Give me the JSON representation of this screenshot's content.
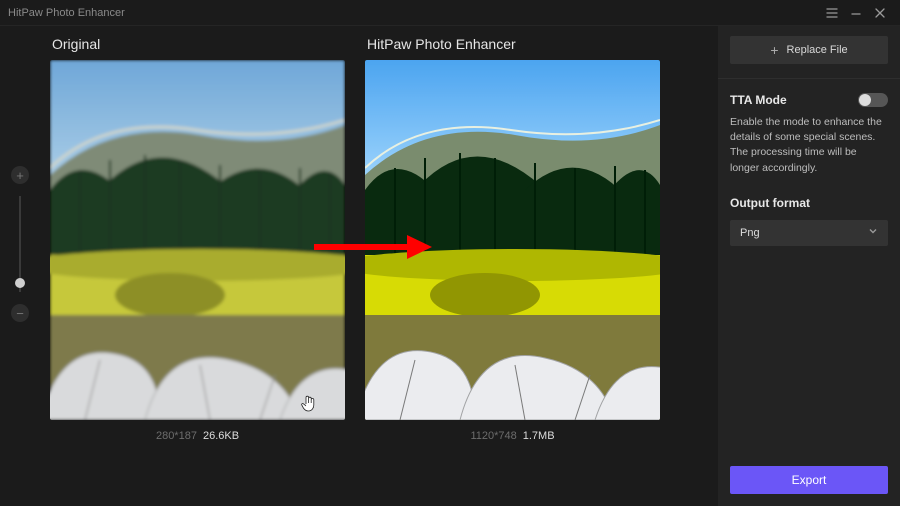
{
  "window": {
    "title": "HitPaw Photo Enhancer"
  },
  "preview": {
    "original_label": "Original",
    "enhanced_label": "HitPaw Photo Enhancer",
    "original_dim": "280*187",
    "original_size": "26.6KB",
    "enhanced_dim": "1120*748",
    "enhanced_size": "1.7MB"
  },
  "sidebar": {
    "replace_label": "Replace File",
    "tta_label": "TTA Mode",
    "tta_on": false,
    "tta_desc": "Enable the mode to enhance the details of some special scenes. The processing time will be longer accordingly.",
    "output_format_label": "Output format",
    "output_format_value": "Png",
    "export_label": "Export"
  },
  "icons": {
    "menu": "menu-icon",
    "minimize": "minimize-icon",
    "close": "close-icon",
    "plus": "plus-icon",
    "chevron_down": "chevron-down-icon",
    "hand_cursor": "hand-cursor-icon"
  }
}
